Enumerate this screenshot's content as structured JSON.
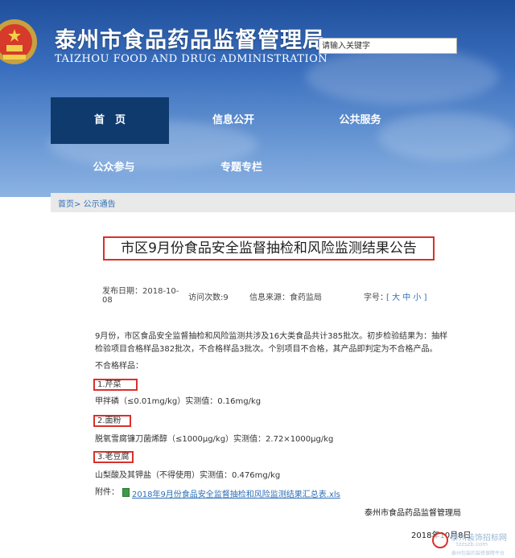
{
  "header": {
    "title": "泰州市食品药品监督管理局",
    "subtitle": "TAIZHOU FOOD AND DRUG ADMINISTRATION",
    "search_placeholder": "请输入关键字",
    "colors": {
      "header_blue": "#2d62b0",
      "nav_active": "#0f3a6e"
    }
  },
  "nav": {
    "items": [
      {
        "label": "首　页",
        "active": true
      },
      {
        "label": "信息公开",
        "active": false
      },
      {
        "label": "公共服务",
        "active": false
      },
      {
        "label": "公众参与",
        "active": false
      },
      {
        "label": "专题专栏",
        "active": false
      }
    ]
  },
  "breadcrumb": {
    "home": "首页",
    "separator": ">",
    "section": "公示通告"
  },
  "article": {
    "title": "市区9月份食品安全监督抽检和风险监测结果公告",
    "meta": {
      "publish_label": "发布日期：2018-10-",
      "publish_tail": "08",
      "views": "访问次数:9",
      "source": "信息来源：食药监局",
      "font_label": "字号：",
      "font_sizes": "[ 大 中 小 ]"
    },
    "intro_line1": "9月份，市区食品安全监督抽检和风险监测共涉及16大类食品共计385批次。初步检验结果为：抽样",
    "intro_line2": "检验项目合格样品382批次，不合格样品3批次。个别项目不合格，其产品即判定为不合格产品。",
    "unqualified_label": "不合格样品：",
    "items": [
      {
        "name": "1.芹菜",
        "detail": "甲拌磷（≤0.01mg/kg）实测值：0.16mg/kg"
      },
      {
        "name": "2.面粉",
        "detail": "脱氧雪腐镰刀菌烯醇（≤1000μg/kg）实测值：2.72×1000μg/kg"
      },
      {
        "name": "3.老豆腐",
        "detail": "山梨酸及其钾盐（不得使用）实测值：0.476mg/kg"
      }
    ],
    "attachment_label": "附件：",
    "attachment_file": "2018年9月份食品安全监督抽检和风险监测结果汇总表.xls",
    "org": "泰州市食品药品监督管理局",
    "date": "2018年10月8日"
  },
  "watermark": {
    "name": "泰州装饰招标网",
    "url": "tzzszb.com",
    "sub": "泰州包装的装修保障平台"
  }
}
